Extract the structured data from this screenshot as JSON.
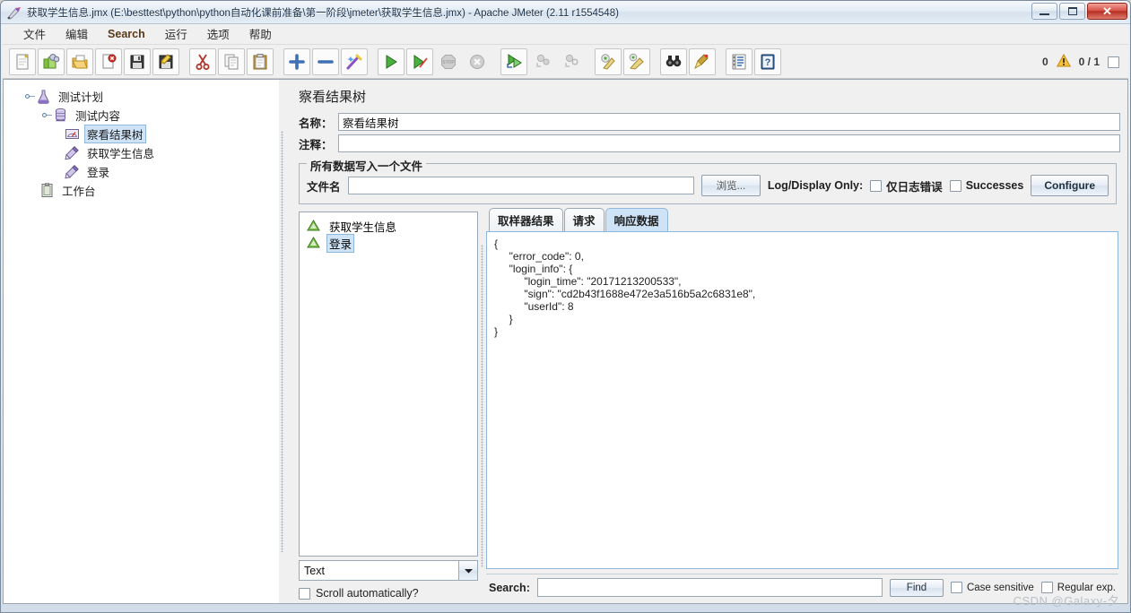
{
  "window": {
    "title": "获取学生信息.jmx (E:\\besttest\\python\\python自动化课前准备\\第一阶段\\jmeter\\获取学生信息.jmx) - Apache JMeter (2.11 r1554548)",
    "icon": "jmeter-feather-icon",
    "minimize_label": "",
    "maximize_label": "",
    "close_label": "✕"
  },
  "menubar": {
    "items": [
      {
        "label": "文件",
        "name": "menu-file"
      },
      {
        "label": "编辑",
        "name": "menu-edit"
      },
      {
        "label": "Search",
        "name": "menu-search"
      },
      {
        "label": "运行",
        "name": "menu-run"
      },
      {
        "label": "选项",
        "name": "menu-options"
      },
      {
        "label": "帮助",
        "name": "menu-help"
      }
    ]
  },
  "toolbar": {
    "buttons": [
      {
        "name": "new-button",
        "icon": "new-document-icon"
      },
      {
        "name": "templates-button",
        "icon": "templates-icon"
      },
      {
        "name": "open-button",
        "icon": "open-folder-icon"
      },
      {
        "name": "close-button",
        "icon": "close-document-icon"
      },
      {
        "name": "save-button",
        "icon": "save-disk-icon"
      },
      {
        "name": "save-as-button",
        "icon": "save-as-icon"
      },
      {
        "name": "cut-button",
        "icon": "scissors-icon"
      },
      {
        "name": "copy-button",
        "icon": "copy-icon"
      },
      {
        "name": "paste-button",
        "icon": "clipboard-icon"
      },
      {
        "name": "expand-all-button",
        "icon": "plus-icon"
      },
      {
        "name": "collapse-all-button",
        "icon": "minus-icon"
      },
      {
        "name": "toggle-button",
        "icon": "toggle-wand-icon"
      },
      {
        "name": "start-button",
        "icon": "play-green-icon"
      },
      {
        "name": "start-no-pauses-button",
        "icon": "play-no-pause-icon"
      },
      {
        "name": "stop-button",
        "icon": "stop-sign-icon"
      },
      {
        "name": "shutdown-button",
        "icon": "shutdown-icon"
      },
      {
        "name": "start-remote-button",
        "icon": "remote-start-icon"
      },
      {
        "name": "stop-remote-button",
        "icon": "remote-stop-icon"
      },
      {
        "name": "shutdown-remote-button",
        "icon": "remote-shutdown-icon"
      },
      {
        "name": "clear-button",
        "icon": "clear-broom-icon"
      },
      {
        "name": "clear-all-button",
        "icon": "clear-all-broom-icon"
      },
      {
        "name": "search-button",
        "icon": "binoculars-icon"
      },
      {
        "name": "reset-search-button",
        "icon": "broom-icon"
      },
      {
        "name": "function-helper-button",
        "icon": "function-list-icon"
      },
      {
        "name": "help-button",
        "icon": "help-book-icon"
      }
    ],
    "warning_count": "0",
    "warning_icon": "warning-triangle-icon",
    "thread_counter": "0 / 1"
  },
  "tree": {
    "nodes": [
      {
        "label": "测试计划",
        "icon": "test-plan-flask-icon",
        "depth": 0,
        "selected": false,
        "name": "tree-node-test-plan"
      },
      {
        "label": "测试内容",
        "icon": "thread-group-icon",
        "depth": 1,
        "selected": false,
        "name": "tree-node-thread-group"
      },
      {
        "label": "察看结果树",
        "icon": "view-results-tree-icon",
        "depth": 2,
        "selected": true,
        "name": "tree-node-view-results-tree"
      },
      {
        "label": "获取学生信息",
        "icon": "http-sampler-icon",
        "depth": 2,
        "selected": false,
        "name": "tree-node-get-student-info"
      },
      {
        "label": "登录",
        "icon": "http-sampler-icon",
        "depth": 2,
        "selected": false,
        "name": "tree-node-login"
      },
      {
        "label": "工作台",
        "icon": "workbench-icon",
        "depth": 0,
        "selected": false,
        "name": "tree-node-workbench"
      }
    ]
  },
  "panel": {
    "title": "察看结果树",
    "name_label": "名称：",
    "name_value": "察看结果树",
    "comment_label": "注释：",
    "comment_value": "",
    "file_group": {
      "legend": "所有数据写入一个文件",
      "filename_label": "文件名",
      "filename_value": "",
      "filename_placeholder": "",
      "browse_button": "浏览...",
      "log_display_label": "Log/Display Only:",
      "errors_checkbox": "仅日志错误",
      "successes_checkbox": "Successes",
      "configure_button": "Configure"
    }
  },
  "results": {
    "items": [
      {
        "label": "获取学生信息",
        "icon": "success-triangle-icon",
        "selected": false,
        "name": "result-item-get-student-info"
      },
      {
        "label": "登录",
        "icon": "success-triangle-icon",
        "selected": true,
        "name": "result-item-login"
      }
    ],
    "renderer_selected": "Text",
    "renderer_arrow_icon": "chevron-down-icon",
    "scroll_auto_label": "Scroll automatically?"
  },
  "detail": {
    "tabs": [
      {
        "label": "取样器结果",
        "active": false,
        "name": "tab-sampler-result"
      },
      {
        "label": "请求",
        "active": false,
        "name": "tab-request"
      },
      {
        "label": "响应数据",
        "active": true,
        "name": "tab-response-data"
      }
    ],
    "response_body": "{\n     \"error_code\": 0,\n     \"login_info\": {\n          \"login_time\": \"20171213200533\",\n          \"sign\": \"cd2b43f1688e472e3a516b5a2c6831e8\",\n          \"userId\": 8\n     }\n}",
    "search_label": "Search:",
    "search_value": "",
    "find_button": "Find",
    "case_sensitive_label": "Case sensitive",
    "regular_exp_label": "Regular exp."
  },
  "watermark": "CSDN @Galaxy-夕",
  "colors": {
    "selection": "#cfe3f7",
    "accent": "#8fb6db",
    "warning": "#f2b01e",
    "window_bg": "#f0f0f0"
  }
}
